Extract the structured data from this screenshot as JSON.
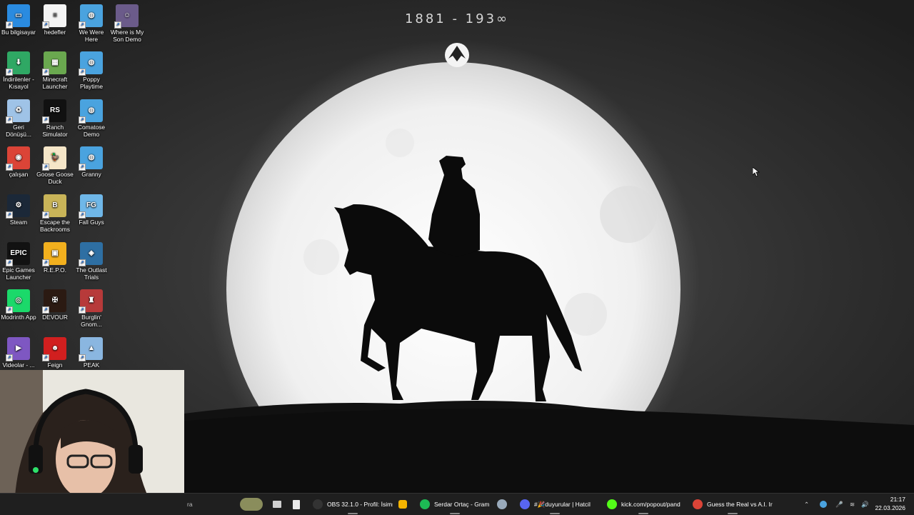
{
  "wallpaper": {
    "years_text": "1881 - 193∞",
    "moon_color": "#f2f2f2",
    "silhouette_color": "#0b0b0b"
  },
  "desktop_icons": [
    {
      "label": "Bu bilgisayar",
      "icon": "computer-icon",
      "color": "#2a8be0"
    },
    {
      "label": "hedefler",
      "icon": "document-icon",
      "color": "#f4f4f4"
    },
    {
      "label": "We Were Here",
      "icon": "globe-icon",
      "color": "#4aa3df"
    },
    {
      "label": "Where is My Son Demo",
      "icon": "game-icon",
      "color": "#6b5b8a"
    },
    {
      "label": "İndirilenler - Kısayol",
      "icon": "download-folder-icon",
      "color": "#2fa864"
    },
    {
      "label": "Minecraft Launcher",
      "icon": "minecraft-icon",
      "color": "#6aa84f"
    },
    {
      "label": "Poppy Playtime",
      "icon": "globe-icon",
      "color": "#4aa3df"
    },
    {
      "label": "Geri Dönüşü...",
      "icon": "recycle-bin-icon",
      "color": "#9fc3e7"
    },
    {
      "label": "Ranch Simulator",
      "icon": "ranch-icon",
      "color": "#111111"
    },
    {
      "label": "Comatose Demo",
      "icon": "globe-icon",
      "color": "#4aa3df"
    },
    {
      "label": "çalışan",
      "icon": "chrome-icon",
      "color": "#db4437"
    },
    {
      "label": "Goose Goose Duck",
      "icon": "goose-icon",
      "color": "#f5e6c8"
    },
    {
      "label": "Granny",
      "icon": "globe-icon",
      "color": "#4aa3df"
    },
    {
      "label": "Steam",
      "icon": "steam-icon",
      "color": "#1b2838"
    },
    {
      "label": "Escape the Backrooms",
      "icon": "backrooms-icon",
      "color": "#c9b458"
    },
    {
      "label": "Fall Guys",
      "icon": "fall-guys-icon",
      "color": "#6fb7e8"
    },
    {
      "label": "Epic Games Launcher",
      "icon": "epic-games-icon",
      "color": "#121212"
    },
    {
      "label": "R.E.P.O.",
      "icon": "repo-icon",
      "color": "#f2b01e"
    },
    {
      "label": "The Outlast Trials",
      "icon": "outlast-icon",
      "color": "#2e6fa3"
    },
    {
      "label": "Modrinth App",
      "icon": "modrinth-icon",
      "color": "#1bd96a"
    },
    {
      "label": "DEVOUR",
      "icon": "devour-icon",
      "color": "#2b1a12"
    },
    {
      "label": "Burglin' Gnom...",
      "icon": "gnome-icon",
      "color": "#b73a3a"
    },
    {
      "label": "Videolar - ...",
      "icon": "video-folder-icon",
      "color": "#7e57c2"
    },
    {
      "label": "Feign",
      "icon": "feign-icon",
      "color": "#d11f1f"
    },
    {
      "label": "PEAK",
      "icon": "peak-icon",
      "color": "#8ab6e0"
    }
  ],
  "taskbar": {
    "search_text": "ra",
    "apps": [
      {
        "label": "OBS 32.1.0 - Profil: İsims",
        "icon": "obs-icon",
        "color": "#333333"
      },
      {
        "label": "Serdar Ortaç - Gram",
        "icon": "spotify-icon",
        "color": "#1db954"
      },
      {
        "label": "#🎉duyurular | Hatcil",
        "icon": "discord-icon",
        "color": "#5865f2"
      },
      {
        "label": "kick.com/popout/pand",
        "icon": "kick-icon",
        "color": "#53fc18"
      },
      {
        "label": "Guess the Real vs A.I. Ir",
        "icon": "chrome-icon",
        "color": "#db4437"
      }
    ],
    "time": "21:17",
    "date": "22.03.2026"
  }
}
